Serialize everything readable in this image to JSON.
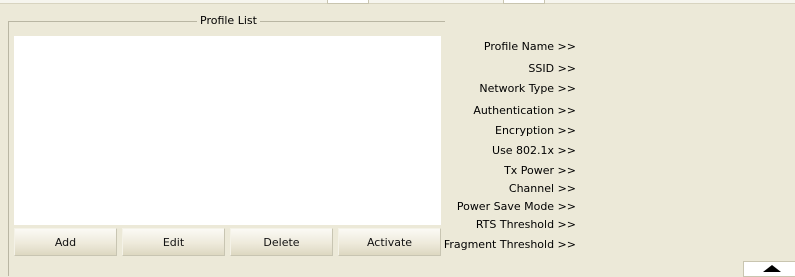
{
  "profile_list": {
    "title": "Profile List",
    "buttons": {
      "add": "Add",
      "edit": "Edit",
      "delete": "Delete",
      "activate": "Activate"
    }
  },
  "details": {
    "profile_name": "Profile Name >>",
    "ssid": "SSID >>",
    "network_type": "Network Type >>",
    "authentication": "Authentication >>",
    "encryption": "Encryption >>",
    "use_8021x": "Use 802.1x >>",
    "tx_power": "Tx Power >>",
    "channel": "Channel >>",
    "power_save_mode": "Power Save Mode >>",
    "rts_threshold": "RTS Threshold >>",
    "fragment_threshold": "Fragment Threshold >>"
  },
  "icons": {
    "scroll_up": "up-arrow-icon"
  }
}
